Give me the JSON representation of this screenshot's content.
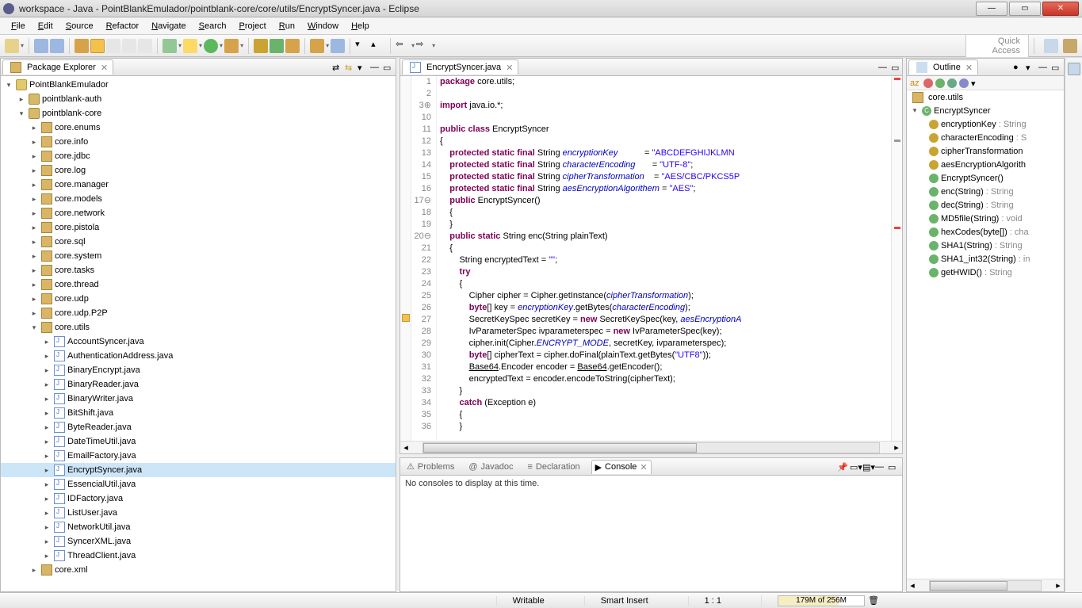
{
  "window": {
    "title": "workspace - Java - PointBlankEmulador/pointblank-core/core/utils/EncryptSyncer.java - Eclipse"
  },
  "menu": [
    "File",
    "Edit",
    "Source",
    "Refactor",
    "Navigate",
    "Search",
    "Project",
    "Run",
    "Window",
    "Help"
  ],
  "quickAccess": "Quick Access",
  "packageExplorer": {
    "title": "Package Explorer",
    "project": "PointBlankEmulador",
    "srcFolders": [
      {
        "name": "pointblank-auth",
        "expanded": false
      },
      {
        "name": "pointblank-core",
        "expanded": true
      }
    ],
    "packages": [
      "core.enums",
      "core.info",
      "core.jdbc",
      "core.log",
      "core.manager",
      "core.models",
      "core.network",
      "core.pistola",
      "core.sql",
      "core.system",
      "core.tasks",
      "core.thread",
      "core.udp",
      "core.udp.P2P"
    ],
    "expandedPackage": "core.utils",
    "javaFiles": [
      "AccountSyncer.java",
      "AuthenticationAddress.java",
      "BinaryEncrypt.java",
      "BinaryReader.java",
      "BinaryWriter.java",
      "BitShift.java",
      "ByteReader.java",
      "DateTimeUtil.java",
      "EmailFactory.java",
      "EncryptSyncer.java",
      "EssencialUtil.java",
      "IDFactory.java",
      "ListUser.java",
      "NetworkUtil.java",
      "SyncerXML.java",
      "ThreadClient.java"
    ],
    "selectedFile": "EncryptSyncer.java",
    "trailingPackage": "core.xml"
  },
  "editor": {
    "tabName": "EncryptSyncer.java",
    "lines": [
      {
        "n": 1,
        "html": "<span class='kw'>package</span> core.utils;"
      },
      {
        "n": 2,
        "html": ""
      },
      {
        "n": "3⊕",
        "html": "<span class='kw'>import</span> java.io.*;"
      },
      {
        "n": 10,
        "html": ""
      },
      {
        "n": 11,
        "html": "<span class='kw'>public class</span> EncryptSyncer"
      },
      {
        "n": 12,
        "html": "{"
      },
      {
        "n": 13,
        "html": "    <span class='kw'>protected static final</span> String <span class='fld'>encryptionKey</span>           = <span class='str'>\"ABCDEFGHIJKLMN</span>"
      },
      {
        "n": 14,
        "html": "    <span class='kw'>protected static final</span> String <span class='fld'>characterEncoding</span>       = <span class='str'>\"UTF-8\"</span>;"
      },
      {
        "n": 15,
        "html": "    <span class='kw'>protected static final</span> String <span class='fld'>cipherTransformation</span>    = <span class='str'>\"AES/CBC/PKCS5P</span>"
      },
      {
        "n": 16,
        "html": "    <span class='kw'>protected static final</span> String <span class='fld'>aesEncryptionAlgorithem</span> = <span class='str'>\"AES\"</span>;"
      },
      {
        "n": "17⊖",
        "html": "    <span class='kw'>public</span> EncryptSyncer()"
      },
      {
        "n": 18,
        "html": "    {"
      },
      {
        "n": 19,
        "html": "    }"
      },
      {
        "n": "20⊖",
        "html": "    <span class='kw'>public static</span> String enc(String plainText)"
      },
      {
        "n": 21,
        "html": "    {"
      },
      {
        "n": 22,
        "html": "        String encryptedText = <span class='str'>\"\"</span>;"
      },
      {
        "n": 23,
        "html": "        <span class='kw'>try</span>"
      },
      {
        "n": 24,
        "html": "        {"
      },
      {
        "n": 25,
        "html": "            Cipher cipher = Cipher.getInstance(<span class='fld'>cipherTransformation</span>);"
      },
      {
        "n": 26,
        "html": "            <span class='kw'>byte</span>[] key = <span class='fld'>encryptionKey</span>.getBytes(<span class='fld'>characterEncoding</span>);"
      },
      {
        "n": 27,
        "html": "            SecretKeySpec secretKey = <span class='kw'>new</span> SecretKeySpec(key, <span class='fld'>aesEncryptionA</span>"
      },
      {
        "n": 28,
        "html": "            IvParameterSpec ivparameterspec = <span class='kw'>new</span> IvParameterSpec(key);"
      },
      {
        "n": 29,
        "html": "            cipher.init(Cipher.<span class='fld'>ENCRYPT_MODE</span>, secretKey, ivparameterspec);"
      },
      {
        "n": 30,
        "html": "            <span class='kw'>byte</span>[] cipherText = cipher.doFinal(plainText.getBytes(<span class='str'>\"UTF8\"</span>));"
      },
      {
        "n": 31,
        "html": "            <u>Base64</u>.Encoder encoder = <u>Base64</u>.getEncoder();"
      },
      {
        "n": 32,
        "html": "            encryptedText = encoder.encodeToString(cipherText);"
      },
      {
        "n": 33,
        "html": "        }"
      },
      {
        "n": 34,
        "html": "        <span class='kw'>catch</span> (Exception e)"
      },
      {
        "n": 35,
        "html": "        {"
      },
      {
        "n": 36,
        "html": "        }"
      }
    ]
  },
  "outline": {
    "title": "Outline",
    "package": "core.utils",
    "class": "EncryptSyncer",
    "members": [
      {
        "ico": "ye",
        "label": "encryptionKey",
        "rtype": ": String"
      },
      {
        "ico": "ye",
        "label": "characterEncoding",
        "rtype": ": S"
      },
      {
        "ico": "ye",
        "label": "cipherTransformation",
        "rtype": ""
      },
      {
        "ico": "ye",
        "label": "aesEncryptionAlgorith",
        "rtype": ""
      },
      {
        "ico": "gr",
        "label": "EncryptSyncer()",
        "rtype": ""
      },
      {
        "ico": "gr",
        "label": "enc(String)",
        "rtype": ": String"
      },
      {
        "ico": "gr",
        "label": "dec(String)",
        "rtype": ": String"
      },
      {
        "ico": "gr",
        "label": "MD5file(String)",
        "rtype": ": void"
      },
      {
        "ico": "gr",
        "label": "hexCodes(byte[])",
        "rtype": ": cha"
      },
      {
        "ico": "gr",
        "label": "SHA1(String)",
        "rtype": ": String"
      },
      {
        "ico": "gr",
        "label": "SHA1_int32(String)",
        "rtype": ": in"
      },
      {
        "ico": "gr",
        "label": "getHWID()",
        "rtype": ": String"
      }
    ]
  },
  "bottomTabs": {
    "items": [
      "Problems",
      "Javadoc",
      "Declaration",
      "Console"
    ],
    "active": "Console",
    "consoleMsg": "No consoles to display at this time."
  },
  "status": {
    "writable": "Writable",
    "insert": "Smart Insert",
    "pos": "1 : 1",
    "heap": "179M of 256M",
    "heapPct": 70
  }
}
